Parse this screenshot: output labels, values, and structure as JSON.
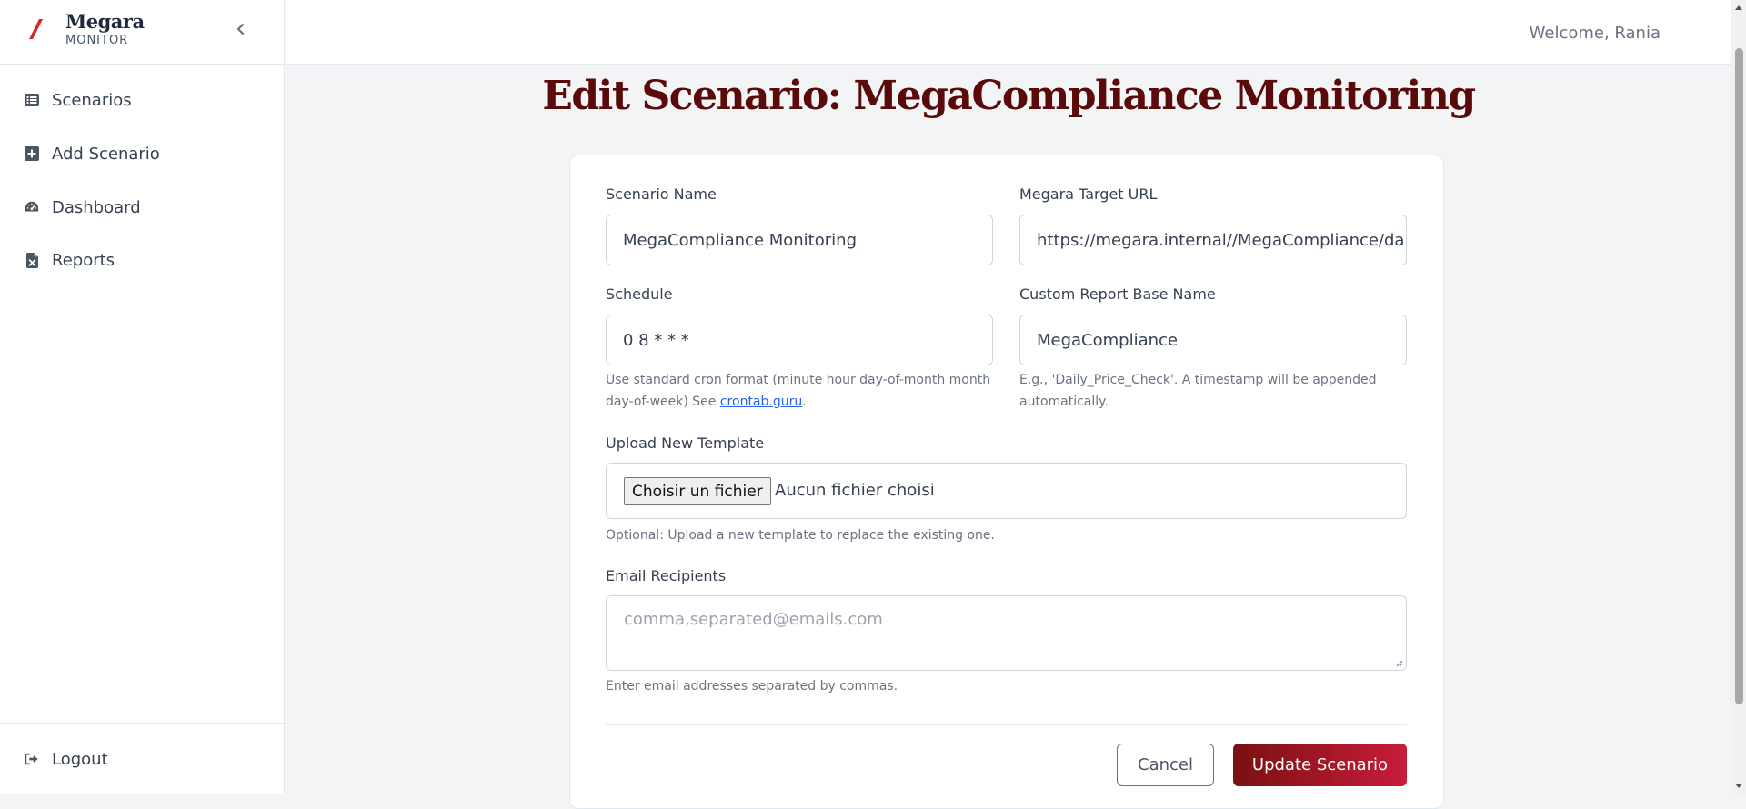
{
  "brand": {
    "name": "Megara",
    "subtitle": "MONITOR",
    "accent": "#dc2626"
  },
  "sidebar": {
    "items": [
      {
        "label": "Scenarios",
        "icon": "list-icon"
      },
      {
        "label": "Add Scenario",
        "icon": "plus-square-icon"
      },
      {
        "label": "Dashboard",
        "icon": "gauge-icon"
      },
      {
        "label": "Reports",
        "icon": "file-excel-icon"
      }
    ],
    "logout": {
      "label": "Logout",
      "icon": "logout-icon"
    }
  },
  "header": {
    "welcome": "Welcome, Rania"
  },
  "page": {
    "title": "Edit Scenario: MegaCompliance Monitoring",
    "title_color": "#5b0a0a"
  },
  "form": {
    "scenario_name": {
      "label": "Scenario Name",
      "value": "MegaCompliance Monitoring"
    },
    "target_url": {
      "label": "Megara Target URL",
      "value": "https://megara.internal//MegaCompliance/daily"
    },
    "schedule": {
      "label": "Schedule",
      "value": "0 8 * * *",
      "help_prefix": "Use standard cron format (minute hour day-of-month month day-of-week) See ",
      "help_link": "crontab.guru",
      "help_suffix": "."
    },
    "report_base": {
      "label": "Custom Report Base Name",
      "value": "MegaCompliance",
      "help": "E.g., 'Daily_Price_Check'. A timestamp will be appended automatically."
    },
    "template": {
      "label": "Upload New Template",
      "button": "Choisir un fichier",
      "status": "Aucun fichier choisi",
      "help": "Optional: Upload a new template to replace the existing one."
    },
    "recipients": {
      "label": "Email Recipients",
      "placeholder": "comma,separated@emails.com",
      "help": "Enter email addresses separated by commas."
    },
    "cancel_label": "Cancel",
    "submit_label": "Update Scenario",
    "submit_color": "#a31226"
  }
}
